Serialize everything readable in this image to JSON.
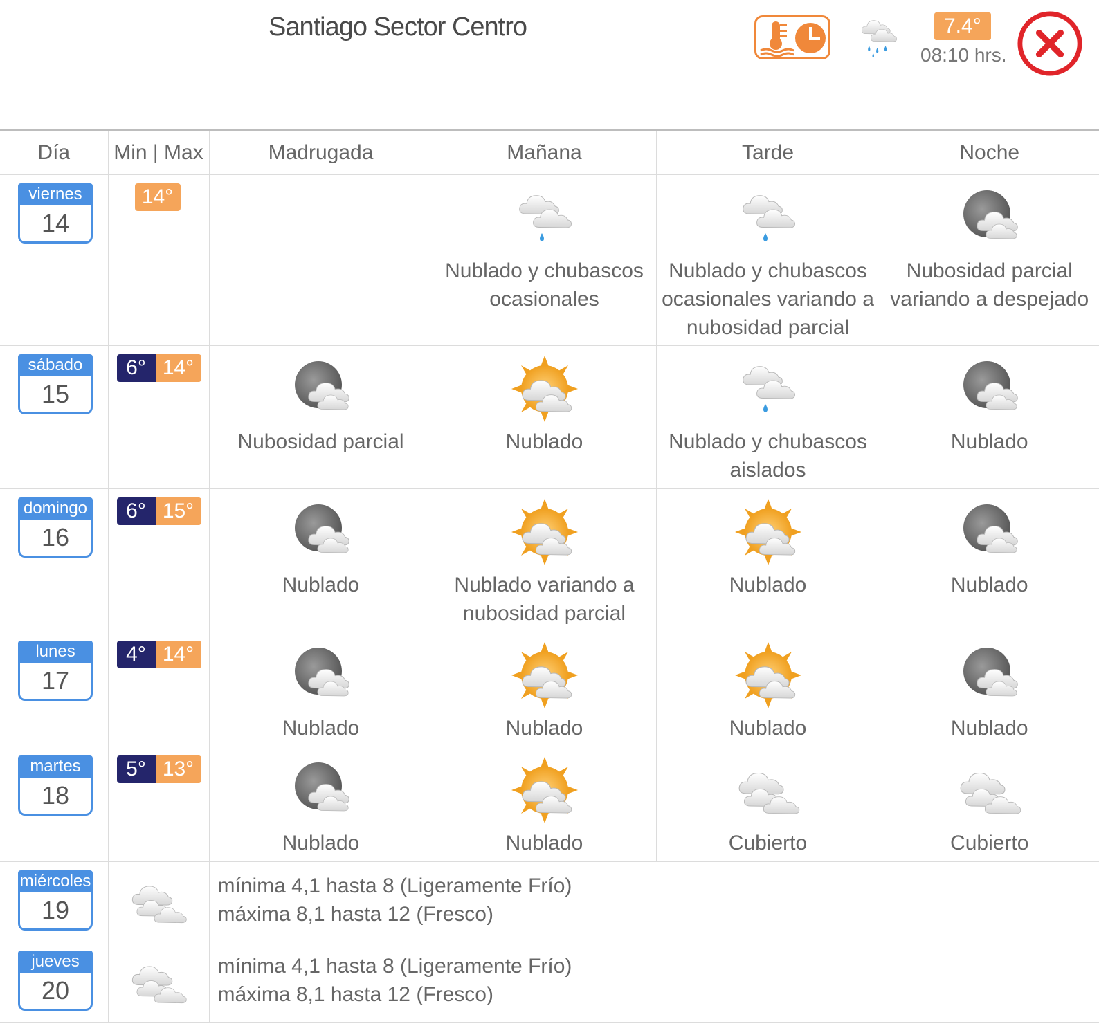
{
  "header": {
    "location": "Santiago Sector Centro",
    "current_temp": "7.4°",
    "current_time": "08:10 hrs.",
    "history_icon": "thermometer-clock-icon",
    "current_icon": "cloud-rain-icon",
    "close_icon": "close-icon"
  },
  "colors": {
    "min_bg": "#24256b",
    "max_bg": "#f5a55a",
    "day_blue": "#4a90e2",
    "close_red": "#e0252a"
  },
  "columns": [
    "Día",
    "Min | Max",
    "Madrugada",
    "Mañana",
    "Tarde",
    "Noche"
  ],
  "days": [
    {
      "name": "viernes",
      "num": "14",
      "min": "",
      "max": "14°",
      "periods": [
        {
          "icon": "",
          "text": ""
        },
        {
          "icon": "cloud-showers",
          "text": "Nublado y chubascos ocasionales"
        },
        {
          "icon": "cloud-showers",
          "text": "Nublado y chubascos ocasionales variando a nubosidad parcial"
        },
        {
          "icon": "moon-cloud",
          "text": "Nubosidad parcial variando a despejado"
        }
      ]
    },
    {
      "name": "sábado",
      "num": "15",
      "min": "6°",
      "max": "14°",
      "periods": [
        {
          "icon": "moon-cloud",
          "text": "Nubosidad parcial"
        },
        {
          "icon": "sun-cloud",
          "text": "Nublado"
        },
        {
          "icon": "cloud-showers",
          "text": "Nublado y chubascos aislados"
        },
        {
          "icon": "moon-cloud",
          "text": "Nublado"
        }
      ]
    },
    {
      "name": "domingo",
      "num": "16",
      "min": "6°",
      "max": "15°",
      "periods": [
        {
          "icon": "moon-cloud",
          "text": "Nublado"
        },
        {
          "icon": "sun-cloud",
          "text": "Nublado variando a nubosidad parcial"
        },
        {
          "icon": "sun-cloud",
          "text": "Nublado"
        },
        {
          "icon": "moon-cloud",
          "text": "Nublado"
        }
      ]
    },
    {
      "name": "lunes",
      "num": "17",
      "min": "4°",
      "max": "14°",
      "periods": [
        {
          "icon": "moon-cloud",
          "text": "Nublado"
        },
        {
          "icon": "sun-cloud",
          "text": "Nublado"
        },
        {
          "icon": "sun-cloud",
          "text": "Nublado"
        },
        {
          "icon": "moon-cloud",
          "text": "Nublado"
        }
      ]
    },
    {
      "name": "martes",
      "num": "18",
      "min": "5°",
      "max": "13°",
      "periods": [
        {
          "icon": "moon-cloud",
          "text": "Nublado"
        },
        {
          "icon": "sun-cloud",
          "text": "Nublado"
        },
        {
          "icon": "overcast",
          "text": "Cubierto"
        },
        {
          "icon": "overcast",
          "text": "Cubierto"
        }
      ]
    }
  ],
  "extended": [
    {
      "name": "miércoles",
      "num": "19",
      "icon": "overcast",
      "line1": "mínima 4,1 hasta 8 (Ligeramente Frío)",
      "line2": "máxima 8,1 hasta 12 (Fresco)"
    },
    {
      "name": "jueves",
      "num": "20",
      "icon": "overcast",
      "line1": "mínima 4,1 hasta 8 (Ligeramente Frío)",
      "line2": "máxima 8,1 hasta 12 (Fresco)"
    }
  ]
}
